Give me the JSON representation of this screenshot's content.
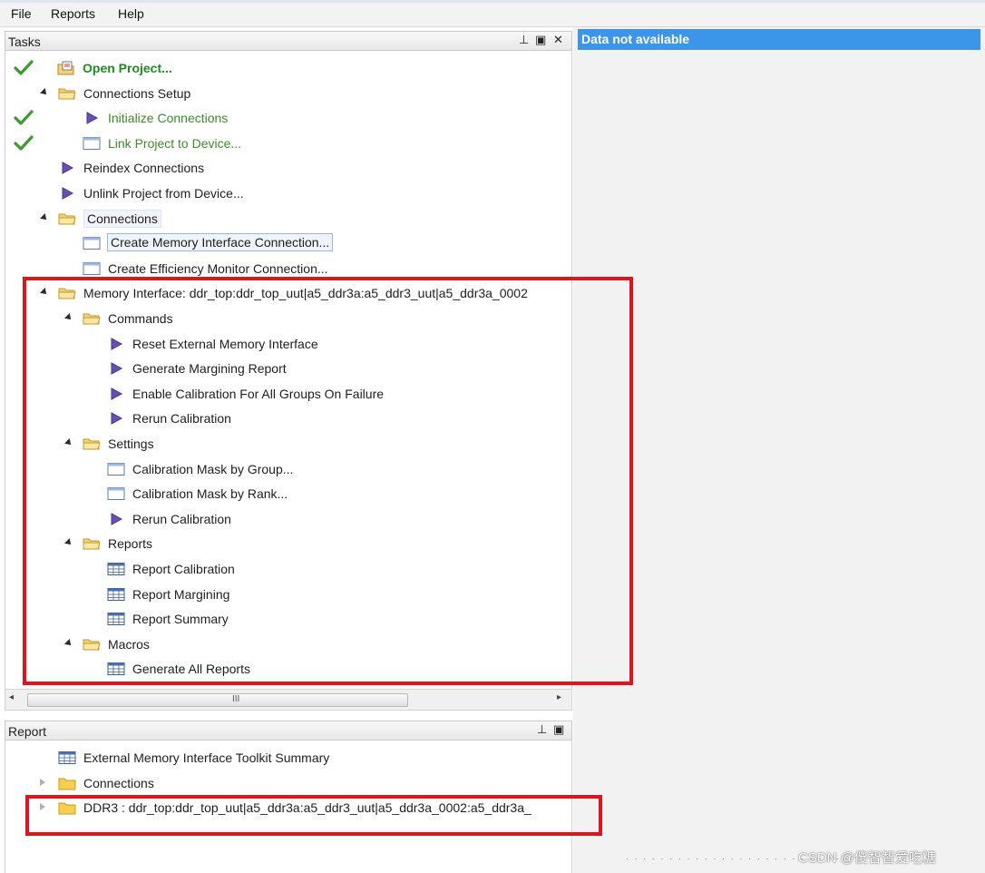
{
  "menu": {
    "file": "File",
    "reports": "Reports",
    "help": "Help"
  },
  "tasks_panel": {
    "title": "Tasks",
    "buttons": {
      "pin": "⊥",
      "float": "▣",
      "close": "✕"
    },
    "rows": [
      {
        "label": "Open Project...",
        "style": "bold-green",
        "icon": "open-project-icon",
        "checked": true
      },
      {
        "label": "Connections Setup",
        "style": "normal",
        "icon": "folder-icon",
        "expander": "open"
      },
      {
        "label": "Initialize Connections",
        "style": "green",
        "icon": "run-command-icon",
        "checked": true
      },
      {
        "label": "Link Project to Device...",
        "style": "green",
        "icon": "dialog-icon",
        "checked": true
      },
      {
        "label": "Reindex Connections",
        "style": "normal",
        "icon": "run-command-icon"
      },
      {
        "label": "Unlink Project from Device...",
        "style": "normal",
        "icon": "run-command-icon"
      },
      {
        "label": "Connections",
        "style": "hover",
        "icon": "folder-icon",
        "expander": "open"
      },
      {
        "label": "Create Memory Interface Connection...",
        "style": "selected",
        "icon": "dialog-icon"
      },
      {
        "label": "Create Efficiency Monitor Connection...",
        "style": "normal",
        "icon": "dialog-icon"
      },
      {
        "label": "Memory Interface: ddr_top:ddr_top_uut|a5_ddr3a:a5_ddr3_uut|a5_ddr3a_0002",
        "style": "normal",
        "icon": "folder-icon",
        "expander": "open"
      },
      {
        "label": "Commands",
        "style": "normal",
        "icon": "folder-icon",
        "expander": "open"
      },
      {
        "label": "Reset External Memory Interface",
        "style": "normal",
        "icon": "run-command-icon"
      },
      {
        "label": "Generate Margining Report",
        "style": "normal",
        "icon": "run-command-icon"
      },
      {
        "label": "Enable Calibration For All Groups On Failure",
        "style": "normal",
        "icon": "run-command-icon"
      },
      {
        "label": "Rerun Calibration",
        "style": "normal",
        "icon": "run-command-icon"
      },
      {
        "label": "Settings",
        "style": "normal",
        "icon": "folder-icon",
        "expander": "open"
      },
      {
        "label": "Calibration Mask by Group...",
        "style": "normal",
        "icon": "dialog-icon"
      },
      {
        "label": "Calibration Mask by Rank...",
        "style": "normal",
        "icon": "dialog-icon"
      },
      {
        "label": "Rerun Calibration",
        "style": "normal",
        "icon": "run-command-icon"
      },
      {
        "label": "Reports",
        "style": "normal",
        "icon": "folder-icon",
        "expander": "open"
      },
      {
        "label": "Report Calibration",
        "style": "normal",
        "icon": "table-icon"
      },
      {
        "label": "Report Margining",
        "style": "normal",
        "icon": "table-icon"
      },
      {
        "label": "Report Summary",
        "style": "normal",
        "icon": "table-icon"
      },
      {
        "label": "Macros",
        "style": "normal",
        "icon": "folder-icon",
        "expander": "open"
      },
      {
        "label": "Generate All Reports",
        "style": "normal",
        "icon": "table-icon"
      }
    ],
    "scrollbar_grip": "III"
  },
  "report_panel": {
    "title": "Report",
    "buttons": {
      "pin": "⊥",
      "float": "▣"
    },
    "rows": [
      {
        "label": "External Memory Interface Toolkit Summary",
        "icon": "table-icon"
      },
      {
        "label": "Connections",
        "icon": "closed-folder-icon",
        "expander": "closed"
      },
      {
        "label": "DDR3 : ddr_top:ddr_top_uut|a5_ddr3a:a5_ddr3_uut|a5_ddr3a_0002:a5_ddr3a_",
        "icon": "closed-folder-icon",
        "expander": "closed"
      }
    ]
  },
  "right_pane": {
    "banner": "Data not available"
  },
  "watermark": "CSDN @傻智智爱吃糖",
  "colors": {
    "highlight_red": "#e0141b",
    "banner_blue": "#3d95ea",
    "done_green": "#3e8a2a"
  }
}
